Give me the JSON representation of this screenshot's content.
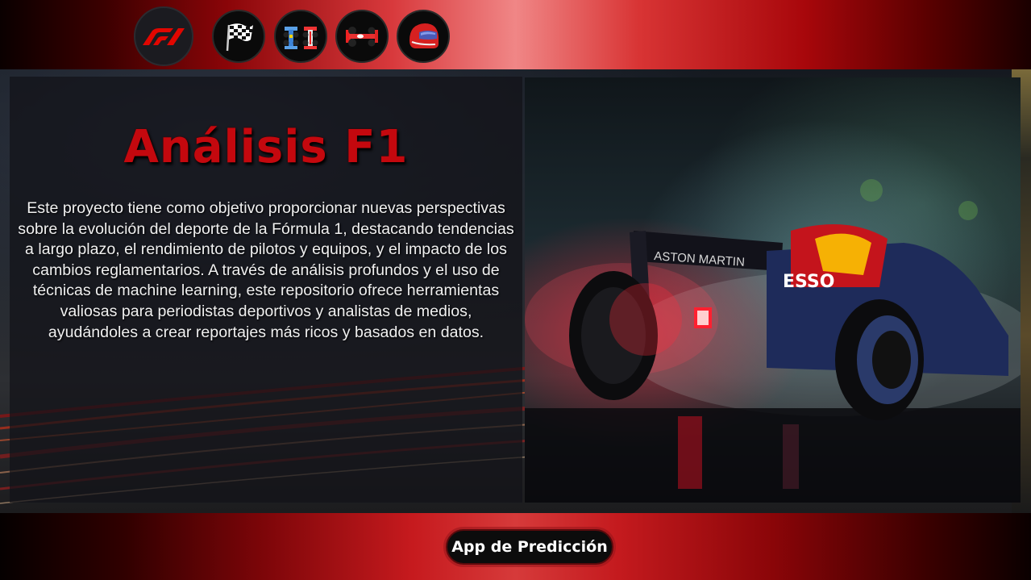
{
  "nav": {
    "icons": [
      {
        "name": "f1-logo-icon"
      },
      {
        "name": "checkered-flag-icon"
      },
      {
        "name": "team-cars-icon"
      },
      {
        "name": "race-car-icon"
      },
      {
        "name": "helmet-icon"
      }
    ]
  },
  "main": {
    "title": "Análisis F1",
    "description": "Este proyecto tiene como objetivo proporcionar nuevas perspectivas sobre la evolución del deporte de la Fórmula 1, destacando tendencias a largo plazo, el rendimiento de pilotos y equipos, y el impacto de los cambios reglamentarios. A través de análisis profundos y el uso de técnicas de machine learning, este repositorio ofrece herramientas valiosas para periodistas deportivos y analistas de medios, ayudándoles a crear reportajes más ricos y basados en datos."
  },
  "photo": {
    "sponsor_1": "ASTON MARTIN",
    "sponsor_2": "ESSO"
  },
  "footer": {
    "button_label": "App de Predicción"
  },
  "colors": {
    "accent_red": "#c4080e",
    "bar_highlight": "#f08686",
    "text": "#f0f0f0"
  }
}
